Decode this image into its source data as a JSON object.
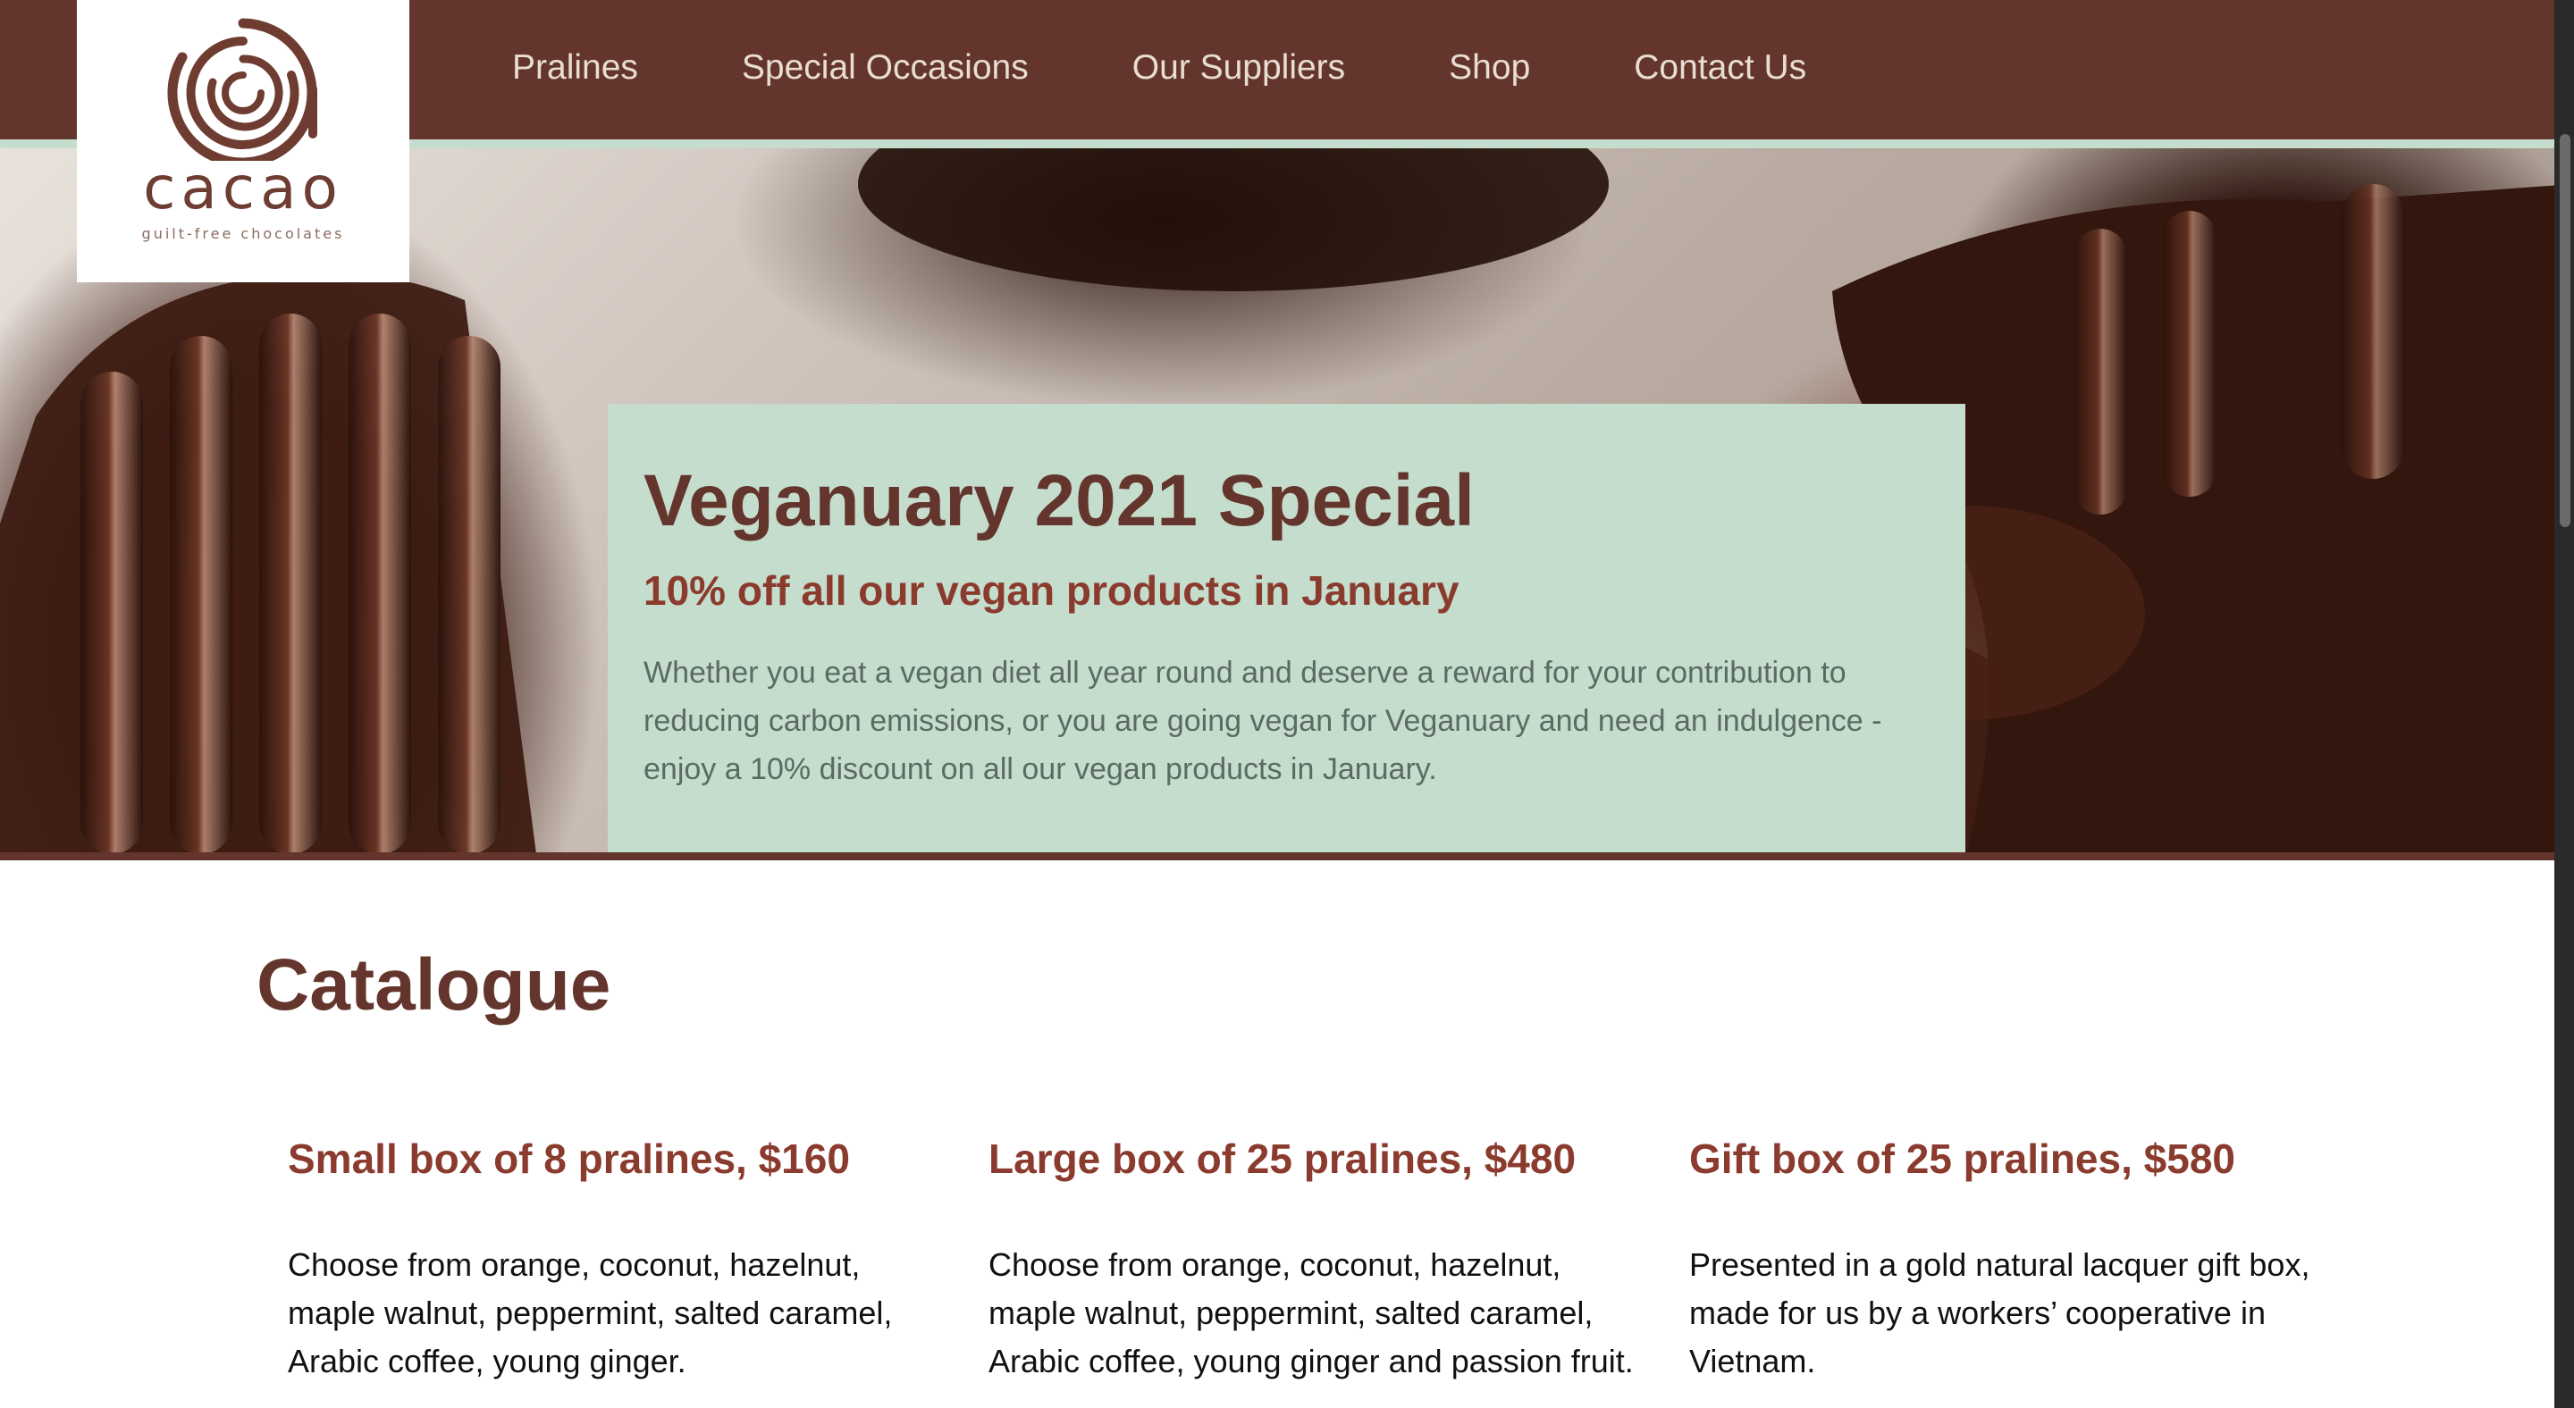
{
  "brand": {
    "logo_word": "cacao",
    "tagline": "guilt-free chocolates",
    "colors": {
      "primary": "#64352c",
      "accent": "#c5ddcd",
      "heading_accent": "#8a3b2e"
    }
  },
  "nav": {
    "items": [
      {
        "label": "Pralines"
      },
      {
        "label": "Special Occasions"
      },
      {
        "label": "Our Suppliers"
      },
      {
        "label": "Shop"
      },
      {
        "label": "Contact Us"
      }
    ]
  },
  "hero": {
    "title": "Veganuary 2021 Special",
    "subtitle": "10% off all our vegan products in January",
    "body": "Whether you eat a vegan diet all year round and deserve a reward for your contribution to reducing carbon emissions, or you are going vegan for Veganuary and need an indulgence - enjoy a 10% discount on all our vegan products in January."
  },
  "catalogue": {
    "title": "Catalogue",
    "products": [
      {
        "title": "Small box of 8 pralines, $160",
        "description": "Choose from orange, coconut, hazelnut, maple walnut, peppermint, salted caramel, Arabic coffee, young ginger."
      },
      {
        "title": "Large box of 25 pralines, $480",
        "description": "Choose from orange, coconut, hazelnut, maple walnut, peppermint, salted caramel, Arabic coffee, young ginger and passion fruit."
      },
      {
        "title": "Gift box of 25 pralines, $580",
        "description": "Presented in a gold natural lacquer gift box, made for us by a workers’ cooperative in Vietnam."
      }
    ]
  }
}
